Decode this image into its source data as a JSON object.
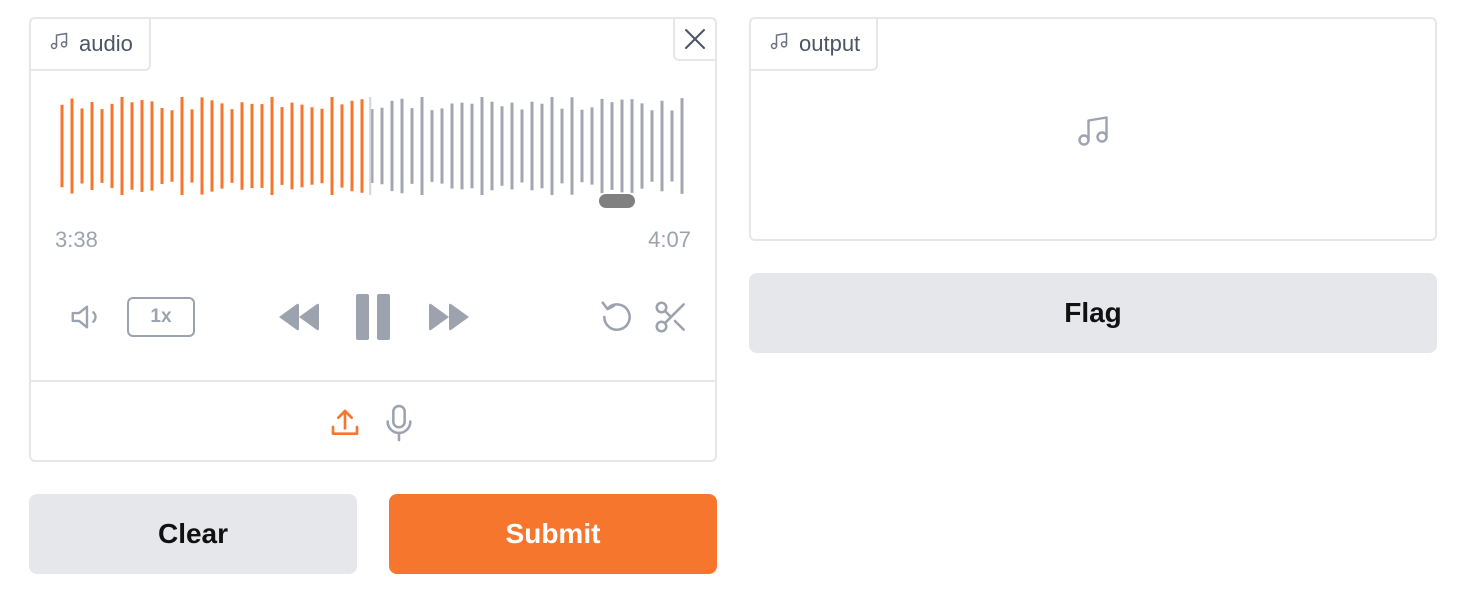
{
  "audio_input": {
    "label": "audio",
    "current_time": "3:38",
    "total_time": "4:07",
    "playback_speed": "1x",
    "progress_fraction": 0.49,
    "played_color": "#f7762d",
    "unplayed_color": "#a1a6b0",
    "icons": {
      "label": "music-note-icon",
      "close": "close-icon",
      "volume": "volume-icon",
      "rewind": "rewind-icon",
      "pause": "pause-icon",
      "fast_forward": "fast-forward-icon",
      "reset": "reset-icon",
      "trim": "scissors-icon",
      "upload": "upload-icon",
      "microphone": "microphone-icon"
    }
  },
  "output": {
    "label": "output",
    "icons": {
      "label": "music-note-icon",
      "placeholder": "music-note-icon"
    }
  },
  "buttons": {
    "clear": "Clear",
    "submit": "Submit",
    "flag": "Flag"
  },
  "colors": {
    "accent": "#f7762d",
    "secondary_button": "#e5e7eb",
    "border": "#e5e7eb",
    "muted_text": "#9ca3af"
  }
}
